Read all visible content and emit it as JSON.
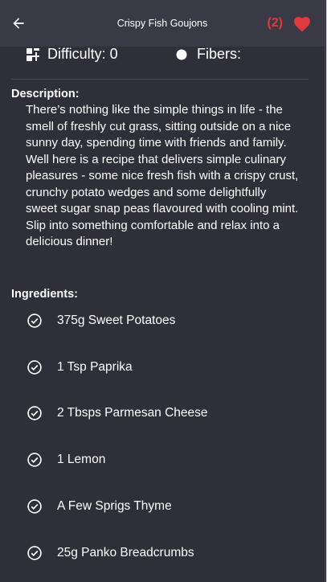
{
  "appbar": {
    "title": "Crispy Fish Goujons",
    "favorite_count": "(2)",
    "back_icon": "arrow-left-icon",
    "favorite_icon": "heart-icon",
    "favorite_color": "#e23a3a"
  },
  "stats": {
    "difficulty": "Difficulty: 0",
    "fibers": "Fibers:"
  },
  "description": {
    "label": "Description:",
    "text": "There’s nothing like the simple things in life - the smell of freshly cut grass, sitting outside on a nice sunny day, spending time with friends and family. Well here is a recipe that delivers simple culinary pleasures - some nice fresh fish with a crispy crust, crunchy potato wedges and some delightfully sweet sugar snap peas flavoured with cooling mint. Slip into something comfortable and relax into a delicious dinner!"
  },
  "ingredients": {
    "label": "Ingredients:",
    "items": [
      "375g Sweet Potatoes",
      "1 Tsp Paprika",
      "2 Tbsps Parmesan Cheese",
      "1 Lemon",
      "A Few Sprigs Thyme",
      "25g Panko Breadcrumbs"
    ]
  }
}
